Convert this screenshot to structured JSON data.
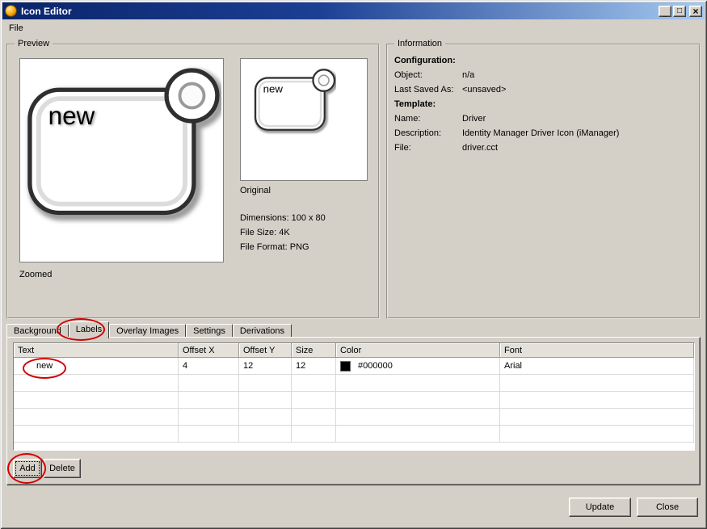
{
  "window": {
    "title": "Icon Editor",
    "titlebar_gradient": [
      "#0a246a",
      "#a6caf0"
    ],
    "controls": {
      "minimize_glyph": "_",
      "maximize_glyph": "□",
      "close_glyph": "×"
    }
  },
  "menu": {
    "file": "File"
  },
  "preview": {
    "legend": "Preview",
    "icon_text": "new",
    "zoomed_caption": "Zoomed",
    "original_caption": "Original",
    "dimensions": "Dimensions: 100 x 80",
    "file_size": "File Size: 4K",
    "file_format": "File Format: PNG"
  },
  "information": {
    "legend": "Information",
    "rows": [
      {
        "label": "Configuration:",
        "value": ""
      },
      {
        "label": "Object:",
        "value": "n/a"
      },
      {
        "label": "Last Saved As:",
        "value": "<unsaved>"
      },
      {
        "label": "Template:",
        "value": ""
      },
      {
        "label": "Name:",
        "value": "Driver"
      },
      {
        "label": "Description:",
        "value": "Identity Manager Driver Icon (iManager)"
      },
      {
        "label": "File:",
        "value": "driver.cct"
      }
    ]
  },
  "tabs": {
    "background": "Background",
    "labels": "Labels",
    "overlay_images": "Overlay Images",
    "settings": "Settings",
    "derivations": "Derivations"
  },
  "labels_table": {
    "columns": [
      "Text",
      "Offset X",
      "Offset Y",
      "Size",
      "Color",
      "Font"
    ],
    "row": {
      "text": "new",
      "offset_x": "4",
      "offset_y": "12",
      "size": "12",
      "color_hex": "#000000",
      "font": "Arial"
    }
  },
  "buttons": {
    "add": "Add",
    "delete": "Delete",
    "update": "Update",
    "close": "Close"
  },
  "annotations": {
    "color": "#d40000"
  }
}
